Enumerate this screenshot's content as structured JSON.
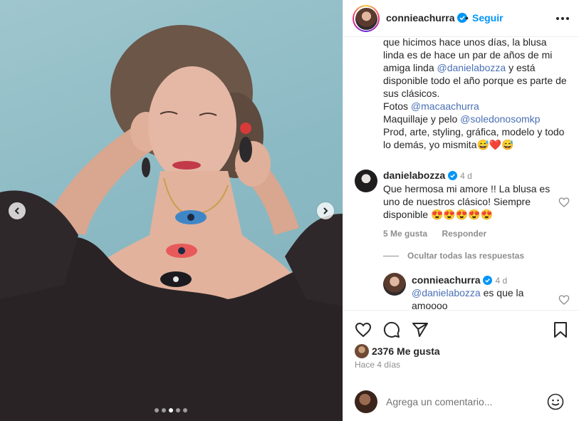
{
  "post": {
    "username": "connieachurra",
    "follow_label": "Seguir",
    "dot_separator": "•"
  },
  "caption": {
    "line1": "que hicimos hace unos días, la blusa linda es de hace un par de años de mi amiga linda ",
    "mention1": "@danielabozza",
    "line2": " y está disponible todo el año porque es parte de sus clásicos.",
    "fotos_label": "Fotos ",
    "mention2": "@macaachurra",
    "maquillaje_label": "Maquillaje y pelo ",
    "mention3": "@soledonosomkp",
    "line3": "Prod, arte, styling, gráfica, modelo y todo lo demás, yo mismita😅❤️😅"
  },
  "comments": [
    {
      "username": "danielabozza",
      "time": "4 d",
      "text": "Que hermosa mi amore !! La blusa es uno de nuestros clásico! Siempre disponible 😍😍😍😍😍",
      "likes": "5 Me gusta",
      "reply_label": "Responder",
      "hide_replies_label": "Ocultar todas las respuestas"
    }
  ],
  "reply": {
    "username": "connieachurra",
    "time": "4 d",
    "mention": "@danielabozza",
    "text": " es que la amoooo"
  },
  "stats": {
    "likes": "2376 Me gusta",
    "time_ago": "Hace 4 días"
  },
  "add_comment": {
    "placeholder": "Agrega un comentario..."
  },
  "carousel": {
    "slide_count": 5,
    "active_slide": 3
  },
  "colors": {
    "link": "#0095f6",
    "mention": "#4a6fb5",
    "verified": "#0095f6",
    "muted": "#8e8e8e",
    "photo_background": "#8cbac4"
  }
}
